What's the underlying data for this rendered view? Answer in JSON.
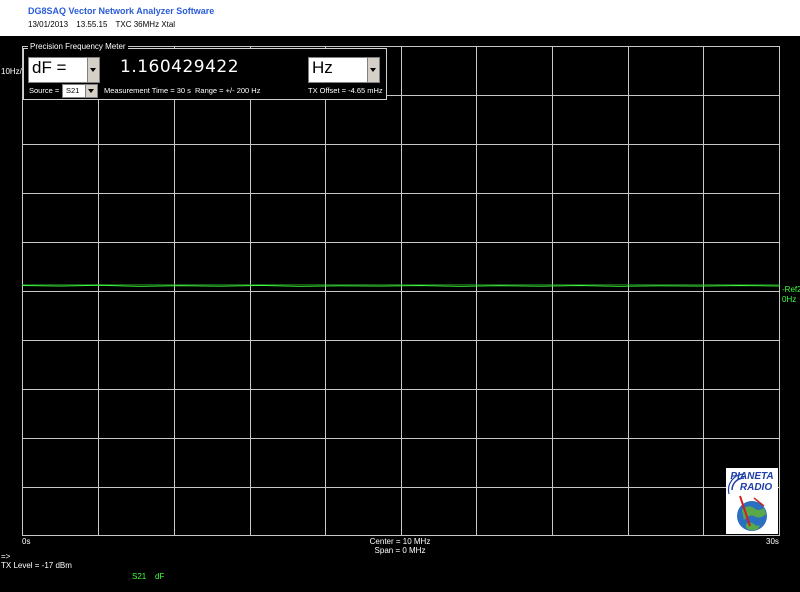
{
  "header": {
    "title": "DG8SAQ Vector Network Analyzer Software",
    "date": "13/01/2013",
    "time": "13.55.15",
    "label": "TXC 36MHz Xtal"
  },
  "plot": {
    "y_top_label": "10Hz/",
    "x_start_label": "0s",
    "x_end_label": "30s",
    "center_label": "Center = 10 MHz",
    "span_label": "Span = 0 MHz",
    "ref_label": "-Ref2",
    "ref_value": "0Hz",
    "arrow_label": "=>",
    "tx_level": "TX Level = -17 dBm",
    "trace_s21": "S21",
    "trace_df": "dF",
    "trace_color": "#40ff40"
  },
  "freq_meter": {
    "title": "Precision Frequency Meter",
    "mode_value": "dF   =",
    "reading": "1.160429422",
    "unit_value": "Hz",
    "source_label": "Source =",
    "source_value": "S21",
    "measurement_time": "Measurement Time = 30 s",
    "range": "Range = +/- 200 Hz",
    "tx_offset": "TX Offset = -4.65 mHz"
  },
  "logo": {
    "line1": "PIANETA",
    "line2": "RADIO"
  }
}
